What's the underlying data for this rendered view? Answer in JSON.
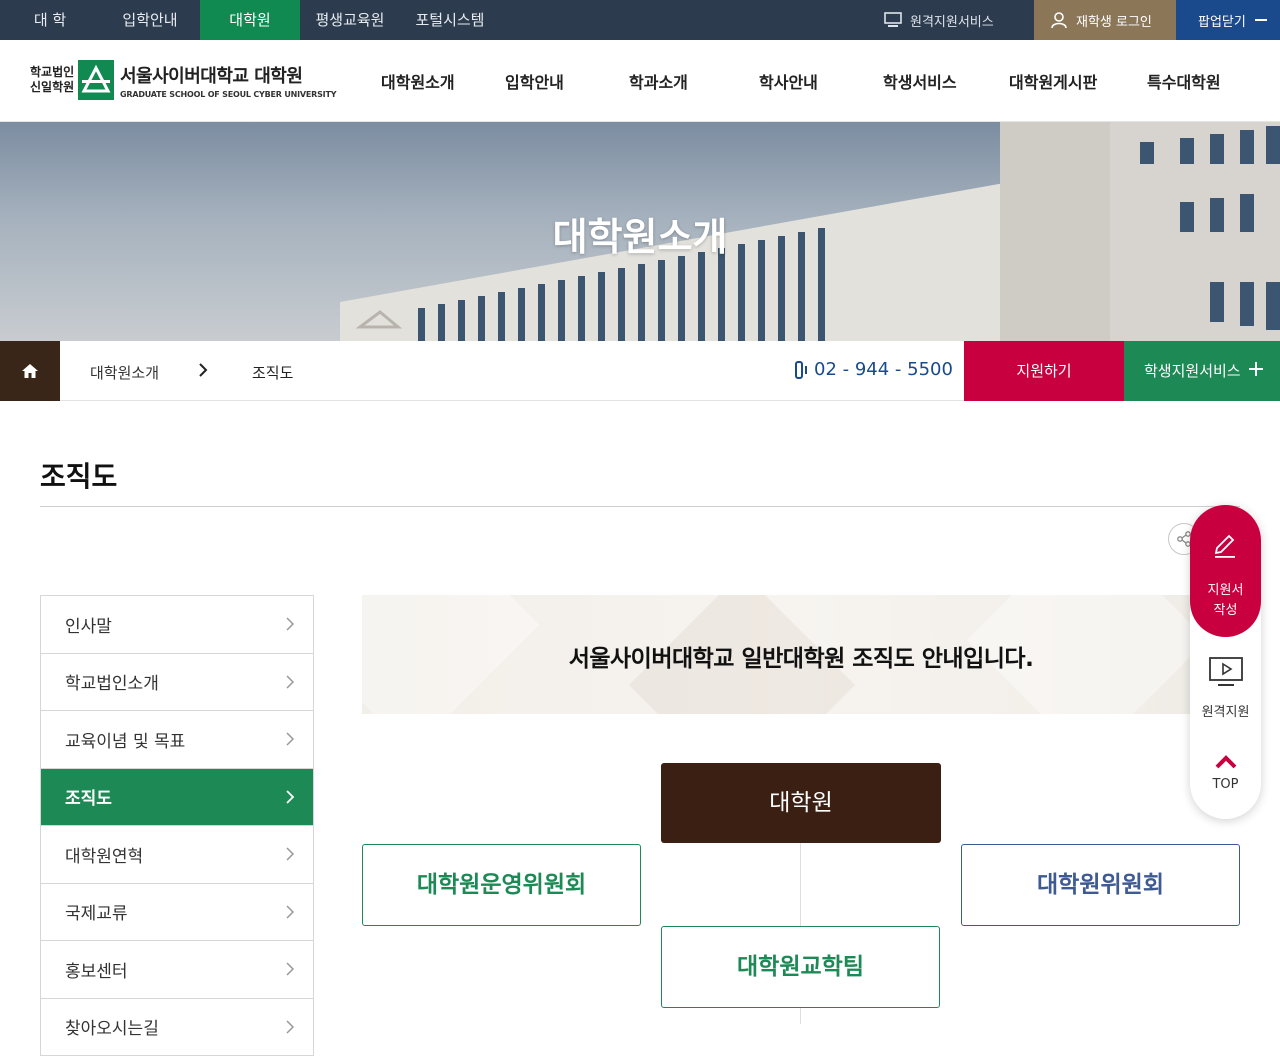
{
  "topnav": {
    "items": [
      {
        "label": "대 학",
        "active": false
      },
      {
        "label": "입학안내",
        "active": false
      },
      {
        "label": "대학원",
        "active": true
      },
      {
        "label": "평생교육원",
        "active": false
      },
      {
        "label": "포털시스템",
        "active": false
      }
    ],
    "remote_service": "원격지원서비스",
    "student_login": "재학생 로그인",
    "close_popup": "팝업닫기"
  },
  "header": {
    "logo_corp_line1": "학교법인",
    "logo_corp_line2": "신일학원",
    "logo_name_ko": "서울사이버대학교 대학원",
    "logo_name_en": "GRADUATE SCHOOL OF SEOUL CYBER UNIVERSITY",
    "gnb": [
      "대학원소개",
      "입학안내",
      "학과소개",
      "학사안내",
      "학생서비스",
      "대학원게시판",
      "특수대학원"
    ]
  },
  "visual": {
    "title": "대학원소개"
  },
  "location": {
    "crumb1": "대학원소개",
    "crumb2": "조직도",
    "phone": "02 - 944 - 5500",
    "apply": "지원하기",
    "student_service": "학생지원서비스"
  },
  "page": {
    "title": "조직도"
  },
  "lnb": [
    {
      "label": "인사말",
      "active": false
    },
    {
      "label": "학교법인소개",
      "active": false
    },
    {
      "label": "교육이념 및 목표",
      "active": false
    },
    {
      "label": "조직도",
      "active": true
    },
    {
      "label": "대학원연혁",
      "active": false
    },
    {
      "label": "국제교류",
      "active": false
    },
    {
      "label": "홍보센터",
      "active": false
    },
    {
      "label": "찾아오시는길",
      "active": false
    }
  ],
  "content": {
    "intro": "서울사이버대학교 일반대학원 조직도 안내입니다.",
    "org": {
      "root": "대학원",
      "left": "대학원운영위원회",
      "right": "대학원위원회",
      "child": "대학원교학팀"
    }
  },
  "quick": {
    "apply_line1": "지원서",
    "apply_line2": "작성",
    "remote": "원격지원",
    "top": "TOP"
  },
  "colors": {
    "topbar": "#2d3b4e",
    "green": "#1d8a55",
    "red": "#c8003f",
    "brown": "#3a1f12",
    "blue": "#3f5a92"
  }
}
